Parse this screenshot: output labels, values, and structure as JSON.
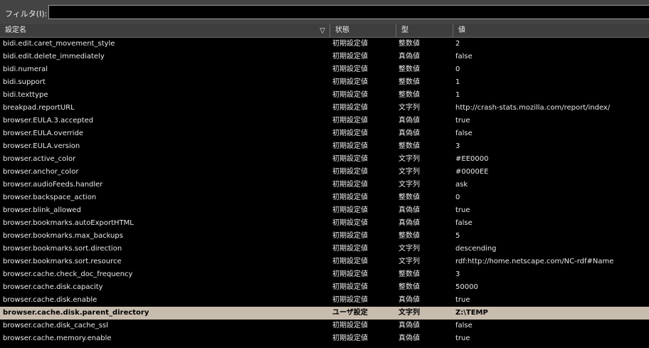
{
  "filter": {
    "label": "フィルタ(I):",
    "value": "",
    "placeholder": ""
  },
  "header": {
    "name": "設定名",
    "sort_glyph": "▽",
    "status": "状態",
    "type": "型",
    "value": "値"
  },
  "rows": [
    {
      "name": "bidi.edit.caret_movement_style",
      "status": "初期設定値",
      "type": "整数値",
      "value": "2"
    },
    {
      "name": "bidi.edit.delete_immediately",
      "status": "初期設定値",
      "type": "真偽値",
      "value": "false"
    },
    {
      "name": "bidi.numeral",
      "status": "初期設定値",
      "type": "整数値",
      "value": "0"
    },
    {
      "name": "bidi.support",
      "status": "初期設定値",
      "type": "整数値",
      "value": "1"
    },
    {
      "name": "bidi.texttype",
      "status": "初期設定値",
      "type": "整数値",
      "value": "1"
    },
    {
      "name": "breakpad.reportURL",
      "status": "初期設定値",
      "type": "文字列",
      "value": "http://crash-stats.mozilla.com/report/index/"
    },
    {
      "name": "browser.EULA.3.accepted",
      "status": "初期設定値",
      "type": "真偽値",
      "value": "true"
    },
    {
      "name": "browser.EULA.override",
      "status": "初期設定値",
      "type": "真偽値",
      "value": "false"
    },
    {
      "name": "browser.EULA.version",
      "status": "初期設定値",
      "type": "整数値",
      "value": "3"
    },
    {
      "name": "browser.active_color",
      "status": "初期設定値",
      "type": "文字列",
      "value": "#EE0000"
    },
    {
      "name": "browser.anchor_color",
      "status": "初期設定値",
      "type": "文字列",
      "value": "#0000EE"
    },
    {
      "name": "browser.audioFeeds.handler",
      "status": "初期設定値",
      "type": "文字列",
      "value": "ask"
    },
    {
      "name": "browser.backspace_action",
      "status": "初期設定値",
      "type": "整数値",
      "value": "0"
    },
    {
      "name": "browser.blink_allowed",
      "status": "初期設定値",
      "type": "真偽値",
      "value": "true"
    },
    {
      "name": "browser.bookmarks.autoExportHTML",
      "status": "初期設定値",
      "type": "真偽値",
      "value": "false"
    },
    {
      "name": "browser.bookmarks.max_backups",
      "status": "初期設定値",
      "type": "整数値",
      "value": "5"
    },
    {
      "name": "browser.bookmarks.sort.direction",
      "status": "初期設定値",
      "type": "文字列",
      "value": "descending"
    },
    {
      "name": "browser.bookmarks.sort.resource",
      "status": "初期設定値",
      "type": "文字列",
      "value": "rdf:http://home.netscape.com/NC-rdf#Name"
    },
    {
      "name": "browser.cache.check_doc_frequency",
      "status": "初期設定値",
      "type": "整数値",
      "value": "3"
    },
    {
      "name": "browser.cache.disk.capacity",
      "status": "初期設定値",
      "type": "整数値",
      "value": "50000"
    },
    {
      "name": "browser.cache.disk.enable",
      "status": "初期設定値",
      "type": "真偽値",
      "value": "true"
    },
    {
      "name": "browser.cache.disk.parent_directory",
      "status": "ユーザ設定",
      "type": "文字列",
      "value": "Z:\\TEMP",
      "selected": true
    },
    {
      "name": "browser.cache.disk_cache_ssl",
      "status": "初期設定値",
      "type": "真偽値",
      "value": "false"
    },
    {
      "name": "browser.cache.memory.enable",
      "status": "初期設定値",
      "type": "真偽値",
      "value": "true"
    }
  ],
  "colors": {
    "background": "#000000",
    "header_background": "#3e3e3e",
    "filter_bar": "#444444",
    "selected_row": "#c8bcae",
    "text": "#e8e8e8"
  }
}
